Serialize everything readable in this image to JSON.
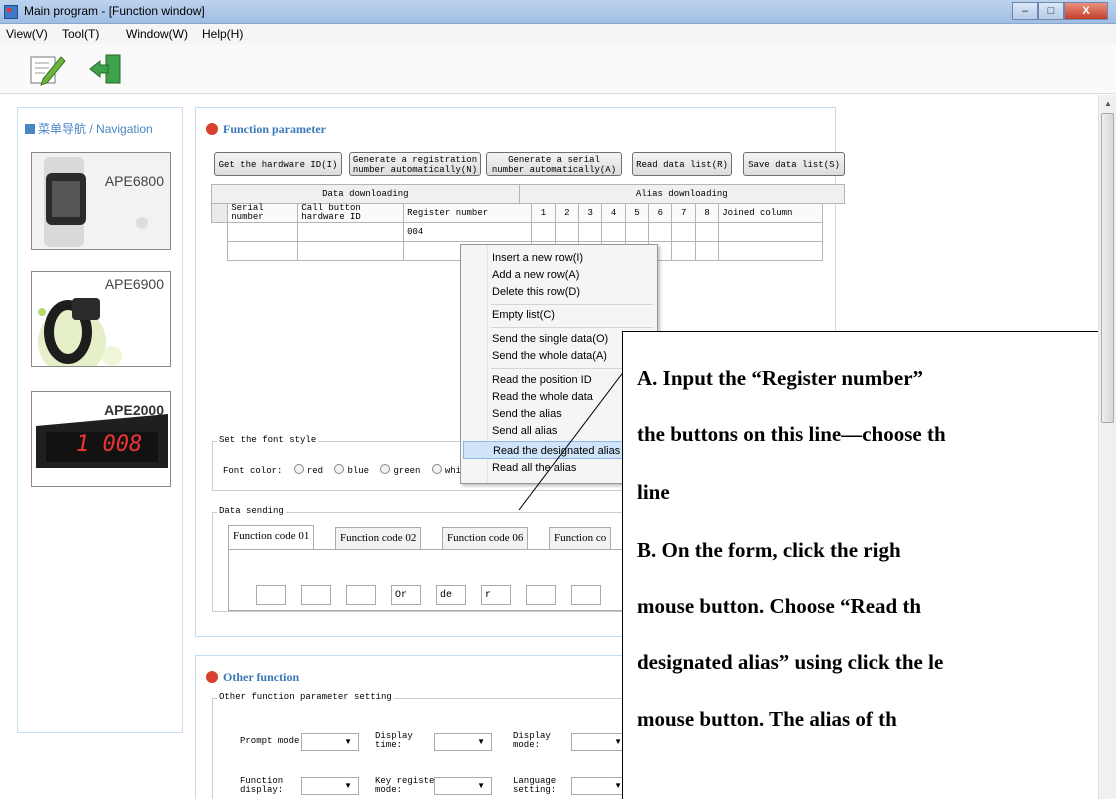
{
  "window": {
    "title": "Main program - [Function window]",
    "controls": {
      "minimize": "–",
      "maximize": "□",
      "close": "X"
    }
  },
  "menubar": {
    "items": [
      "View(V)",
      "Tool(T)",
      "Window(W)",
      "Help(H)"
    ]
  },
  "toolbar": {
    "icons": [
      "edit-icon",
      "exit-icon"
    ]
  },
  "nav": {
    "title_cn": "菜单导航",
    "title_sep": " / ",
    "title_en": "Navigation",
    "devices": [
      "APE6800",
      "APE6900",
      "APE2000"
    ],
    "display_digits": "1 008"
  },
  "function_parameter": {
    "title": "Function parameter",
    "buttons": {
      "get_hw_id": "Get the hardware ID(I)",
      "gen_reg_line1": "Generate a registration",
      "gen_reg_line2": "number automatically(N)",
      "gen_serial_line1": "Generate a serial",
      "gen_serial_line2": "number automatically(A)",
      "read_list": "Read data list(R)",
      "save_list": "Save data list(S)"
    },
    "group_headers": {
      "left": "Data downloading",
      "right": "Alias downloading"
    },
    "columns": {
      "serial_l1": "Serial",
      "serial_l2": "number",
      "hw_l1": "Call button",
      "hw_l2": "hardware ID",
      "register": "Register number",
      "alias_cols": [
        "1",
        "2",
        "3",
        "4",
        "5",
        "6",
        "7",
        "8"
      ],
      "joined": "Joined column"
    },
    "rows": [
      {
        "register": "004"
      }
    ],
    "font_style": {
      "label": "Set the font style",
      "color_label": "Font color:",
      "options": [
        "red",
        "blue",
        "green",
        "whi"
      ]
    },
    "data_sending": {
      "label": "Data sending",
      "tabs": [
        "Function code 01",
        "Function code 02",
        "Function code 06",
        "Function co"
      ],
      "code_values": [
        "Or",
        "de",
        "r"
      ]
    }
  },
  "context_menu": {
    "items": [
      "Insert a new row(I)",
      "Add a new row(A)",
      "Delete this row(D)",
      "Empty list(C)",
      "Send the single data(O)",
      "Send the whole data(A)",
      "Read the position ID",
      "Read the whole data",
      "Send the alias",
      "Send all alias",
      "Read the designated alias",
      "Read all the alias"
    ],
    "highlighted_index": 10
  },
  "other_function": {
    "title": "Other function",
    "setting_label": "Other function parameter setting",
    "labels": {
      "prompt": "Prompt mode:",
      "display_time_1": "Display",
      "display_time_2": "time:",
      "display_mode_1": "Display",
      "display_mode_2": "mode:",
      "func_display_1": "Function",
      "func_display_2": "display:",
      "key_reg_1": "Key register",
      "key_reg_2": "mode:",
      "lang_1": "Language",
      "lang_2": "setting:"
    }
  },
  "annotation": {
    "lines": [
      "A. Input the “Register number” ",
      "the buttons on this line—choose th",
      "line",
      "B.  On  the  form,  click  the  righ",
      "mouse  button.  Choose  “Read  th",
      "designated alias” using click the le",
      "mouse  button.  The  alias  of  th"
    ]
  }
}
